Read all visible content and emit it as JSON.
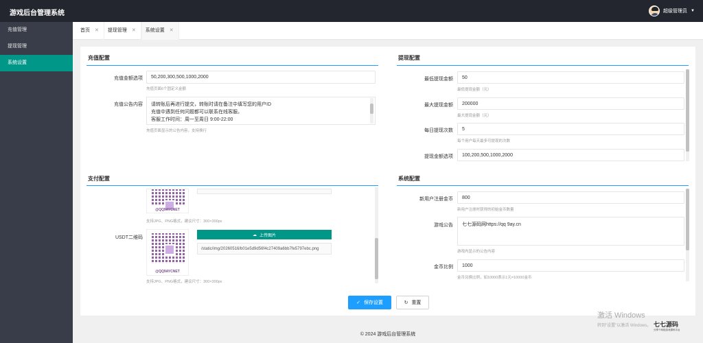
{
  "app": {
    "title": "游戏后台管理系统",
    "user": "超级管理员"
  },
  "sidebar": {
    "items": [
      {
        "label": "充值管理"
      },
      {
        "label": "提现管理"
      },
      {
        "label": "系统设置"
      }
    ]
  },
  "tabs": [
    {
      "label": "首页"
    },
    {
      "label": "提现管理"
    },
    {
      "label": "系统设置"
    }
  ],
  "recharge": {
    "title": "充值配置",
    "amount_label": "充值金额选项",
    "amount_value": "50,200,300,500,1000,2000",
    "amount_hint": "充值页面6个固定义金额",
    "notice_label": "充值公告内容",
    "notice_lines": [
      "请转账后再进行提交，转账时请在备注中填写您的用户ID",
      "充值中遇到任何问题都可以联系在线客服。",
      "客服工作时间：周一至周日 9:00-22:00"
    ],
    "notice_hint": "充值页面显示的公告内容，支持换行"
  },
  "payment": {
    "title": "支付配置",
    "qr_caption": "@QQ9AYCNET",
    "format_hint": "支持JPG、PNG格式，建议尺寸：300×300px",
    "usdt_label": "USDT二维码",
    "upload_label": "上传图片",
    "usdt_path": "/static/img/20260516/b01e5d9d56f4c27409a6bb7fe5797ebc.png",
    "format_hint2": "支持JPG、PNG格式，建议尺寸：300×300px"
  },
  "withdraw": {
    "title": "提现配置",
    "min_label": "最低提现金额",
    "min_value": "50",
    "min_hint": "最低提现金额（元）",
    "max_label": "最大提现金额",
    "max_value": "200000",
    "max_hint": "最大提现金额（元）",
    "daily_label": "每日提现次数",
    "daily_value": "5",
    "daily_hint": "每个用户每天最多可提现的次数",
    "options_label": "提现金额选项",
    "options_value": "100,200,500,1000,2000"
  },
  "system": {
    "title": "系统配置",
    "reg_label": "新用户注册金币",
    "reg_value": "800",
    "reg_hint": "新用户注册时获得的初始金币数量",
    "notice_label": "游戏公告",
    "notice_value": "七七源码网https://qq 9ay.cn",
    "notice_hint": "游戏内显示的公告内容",
    "ratio_label": "金币比例",
    "ratio_value": "1000",
    "ratio_hint": "金币兑换比例，如10000表示1元=10000金币"
  },
  "actions": {
    "save": "保存设置",
    "reset": "重置"
  },
  "footer": "© 2024 游戏后台管理系统",
  "watermark": {
    "title": "激活 Windows",
    "sub": "转到\"设置\"以激活 Windows。"
  },
  "logo": {
    "main": "七七源码",
    "sub": "分享个网络游戏源码平台"
  },
  "colors": {
    "accent": "#009688",
    "primary": "#1e9fff",
    "topbar": "#23262e",
    "sidebar": "#393d49"
  }
}
